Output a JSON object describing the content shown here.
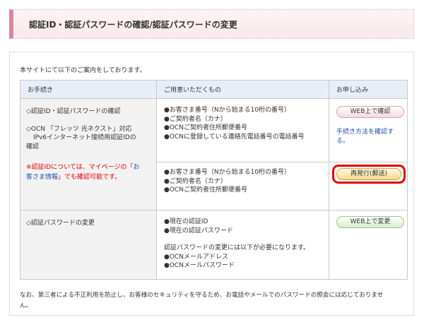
{
  "header": {
    "title": "認証ID・認証パスワードの確認/認証パスワードの変更"
  },
  "intro": "本サイトにて以下のご案内をしております。",
  "table": {
    "headers": [
      "お手続き",
      "ご用意いただくもの",
      "お申し込み"
    ],
    "row1": {
      "procedure_lines": [
        "◇認証ID・認証パスワードの確認",
        "◇OCN 「フレッツ 光ネクスト」対応",
        "IPv6インターネット接続用認証IDの",
        "確認"
      ],
      "note_lines": [
        "※認証IDについては、マイページの「お",
        "客さま情報」でも確認可能です。"
      ],
      "note_parts": {
        "a": "※認証IDについては、マイページの「",
        "b": "お",
        "c": "客さま情報",
        "d": "」でも確認可能です。"
      },
      "items_web": [
        "●お客さま番号（Nから始まる10桁の番号）",
        "●ご契約者名（カナ）",
        "●OCNご契約者住所郵便番号",
        "●OCNに登録している連絡先電話番号の電話番号"
      ],
      "items_mail": [
        "●お客さま番号（Nから始まる10桁の番号）",
        "●ご契約者名（カナ）",
        "●OCNご契約者住所郵便番号"
      ],
      "web_button": "WEB上で確認",
      "help_link_lines": [
        "手続き方法を確認す",
        "る。"
      ],
      "mail_button": "再発行(郵送)"
    },
    "row2": {
      "procedure": "◇認証パスワードの変更",
      "items": [
        "●現在の認証ID",
        "●現在の認証パスワード"
      ],
      "note": "認証パスワードの変更には以下が必要になります。",
      "items2": [
        "●OCNメールアドレス",
        "●OCNメールパスワード"
      ],
      "button": "WEB上で変更"
    }
  },
  "footer_lines": [
    "なお、第三者による不正利用を防止し、お客様のセキュリティを守るため、お電話やメールでのパスワードの照会には応じておりませ",
    "ん。"
  ],
  "colors": {
    "accent": "#d9879c",
    "highlight": "#e00000",
    "link": "#1f4fa8"
  }
}
